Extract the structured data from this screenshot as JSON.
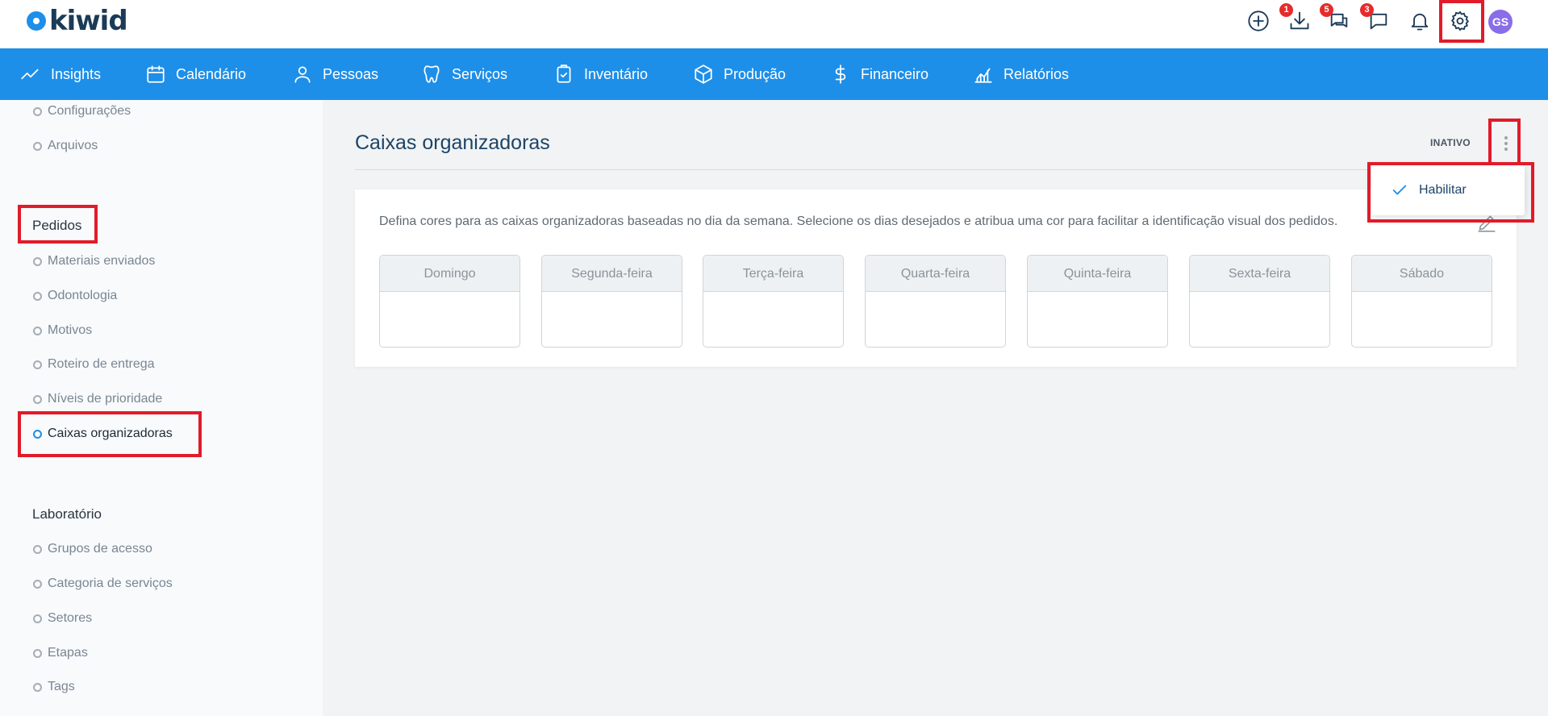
{
  "header": {
    "logo_text": "kiwid",
    "badges": {
      "downloads": "1",
      "messages": "5",
      "chats": "3"
    },
    "avatar_initials": "GS",
    "brand_color": "#1e8fe8",
    "icons": [
      "plus-circle-icon",
      "download-icon",
      "messages-icon",
      "chat-icon",
      "bell-icon",
      "gear-icon"
    ]
  },
  "nav": {
    "items": [
      {
        "label": "Insights",
        "icon": "trend-icon"
      },
      {
        "label": "Calendário",
        "icon": "calendar-icon"
      },
      {
        "label": "Pessoas",
        "icon": "user-icon"
      },
      {
        "label": "Serviços",
        "icon": "tooth-icon"
      },
      {
        "label": "Inventário",
        "icon": "clipboard-icon"
      },
      {
        "label": "Produção",
        "icon": "box-icon"
      },
      {
        "label": "Financeiro",
        "icon": "dollar-icon"
      },
      {
        "label": "Relatórios",
        "icon": "report-icon"
      }
    ]
  },
  "sidebar": {
    "top_links": [
      "Configurações",
      "Arquivos"
    ],
    "pedidos": {
      "heading": "Pedidos",
      "links": [
        "Materiais enviados",
        "Odontologia",
        "Motivos",
        "Roteiro de entrega",
        "Níveis de prioridade",
        "Caixas organizadoras"
      ],
      "active": "Caixas organizadoras"
    },
    "laboratorio": {
      "heading": "Laboratório",
      "links": [
        "Grupos de acesso",
        "Categoria de serviços",
        "Setores",
        "Etapas",
        "Tags"
      ]
    }
  },
  "main": {
    "title": "Caixas organizadoras",
    "status": "INATIVO",
    "description": "Defina cores para as caixas organizadoras baseadas no dia da semana. Selecione os dias desejados e atribua uma cor para facilitar a identificação visual dos pedidos.",
    "days": [
      "Domingo",
      "Segunda-feira",
      "Terça-feira",
      "Quarta-feira",
      "Quinta-feira",
      "Sexta-feira",
      "Sábado"
    ]
  },
  "dropdown": {
    "items": [
      {
        "label": "Habilitar",
        "icon": "check-icon"
      }
    ]
  }
}
